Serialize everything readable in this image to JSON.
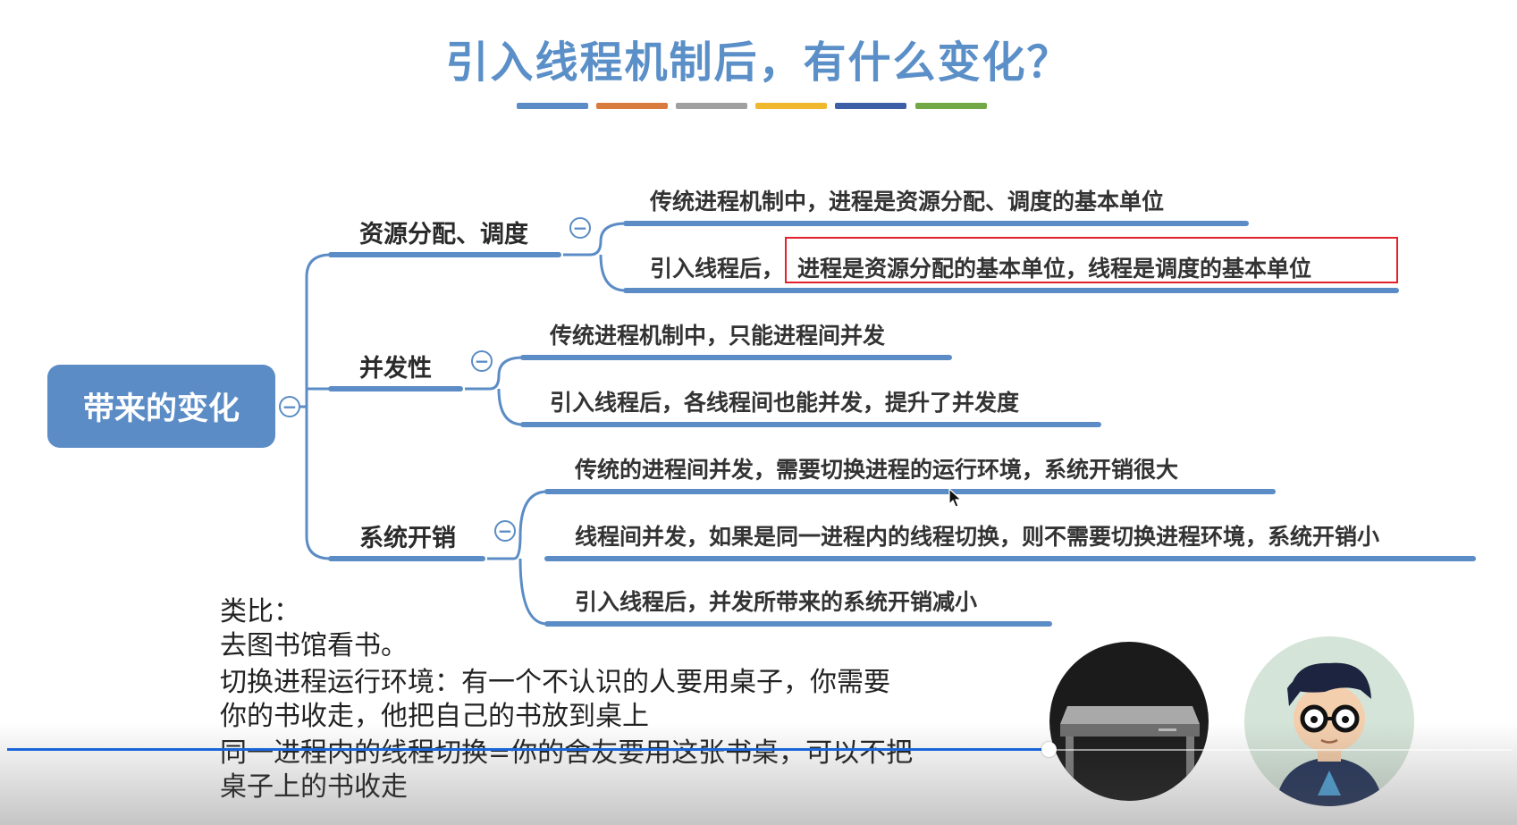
{
  "title": "引入线程机制后，有什么变化？",
  "colors": {
    "title": "#5b8fc8",
    "bars": [
      "#5b8cc6",
      "#d97b3c",
      "#a0a0a0",
      "#f0b92d",
      "#3c5fa8",
      "#72a846"
    ],
    "node": "#5b8cc6",
    "highlight": "#e2212b",
    "progress": "#1a66d8"
  },
  "mindmap": {
    "root": "带来的变化",
    "branches": [
      {
        "label": "资源分配、调度",
        "leaves": [
          "传统进程机制中，进程是资源分配、调度的基本单位",
          {
            "prefix": "引入线程后，",
            "highlight": "进程是资源分配的基本单位，线程是调度的基本单位"
          }
        ]
      },
      {
        "label": "并发性",
        "leaves": [
          "传统进程机制中，只能进程间并发",
          "引入线程后，各线程间也能并发，提升了并发度"
        ]
      },
      {
        "label": "系统开销",
        "leaves": [
          "传统的进程间并发，需要切换进程的运行环境，系统开销很大",
          "线程间并发，如果是同一进程内的线程切换，则不需要切换进程环境，系统开销小",
          "引入线程后，并发所带来的系统开销减小"
        ]
      }
    ]
  },
  "notes": [
    "类比：",
    "去图书馆看书。",
    "切换进程运行环境：有一个不认识的人要用桌子，你需要",
    "你的书收走，他把自己的书放到桌上",
    "同一进程内的线程切换=你的舍友要用这张书桌，可以不把",
    "桌子上的书收走"
  ],
  "video": {
    "progress": 0.692
  },
  "icons": {
    "cursor": "mouse-cursor-icon",
    "table": "desk-icon",
    "person": "person-with-glasses-icon"
  }
}
